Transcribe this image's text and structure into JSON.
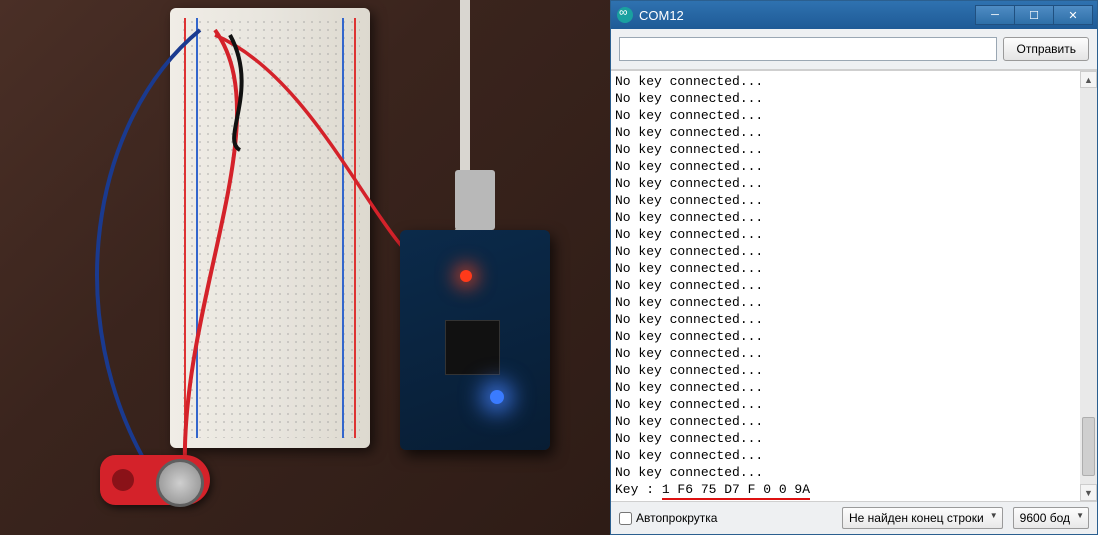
{
  "window": {
    "title": "COM12",
    "min_tooltip": "Minimize",
    "max_tooltip": "Maximize",
    "close_tooltip": "Close"
  },
  "send": {
    "input_value": "",
    "placeholder": "",
    "button_label": "Отправить"
  },
  "output_lines": [
    "No key connected...",
    "No key connected...",
    "No key connected...",
    "No key connected...",
    "No key connected...",
    "No key connected...",
    "No key connected...",
    "No key connected...",
    "No key connected...",
    "No key connected...",
    "No key connected...",
    "No key connected...",
    "No key connected...",
    "No key connected...",
    "No key connected...",
    "No key connected...",
    "No key connected...",
    "No key connected...",
    "No key connected...",
    "No key connected...",
    "No key connected...",
    "No key connected...",
    "No key connected...",
    "No key connected..."
  ],
  "key_line_prefix": "Key : ",
  "key_value": "1 F6 75 D7 F 0 0 9A",
  "footer": {
    "autoscroll_label": "Автопрокрутка",
    "autoscroll_checked": false,
    "line_ending_label": "Не найден конец строки",
    "baud_label": "9600 бод"
  }
}
